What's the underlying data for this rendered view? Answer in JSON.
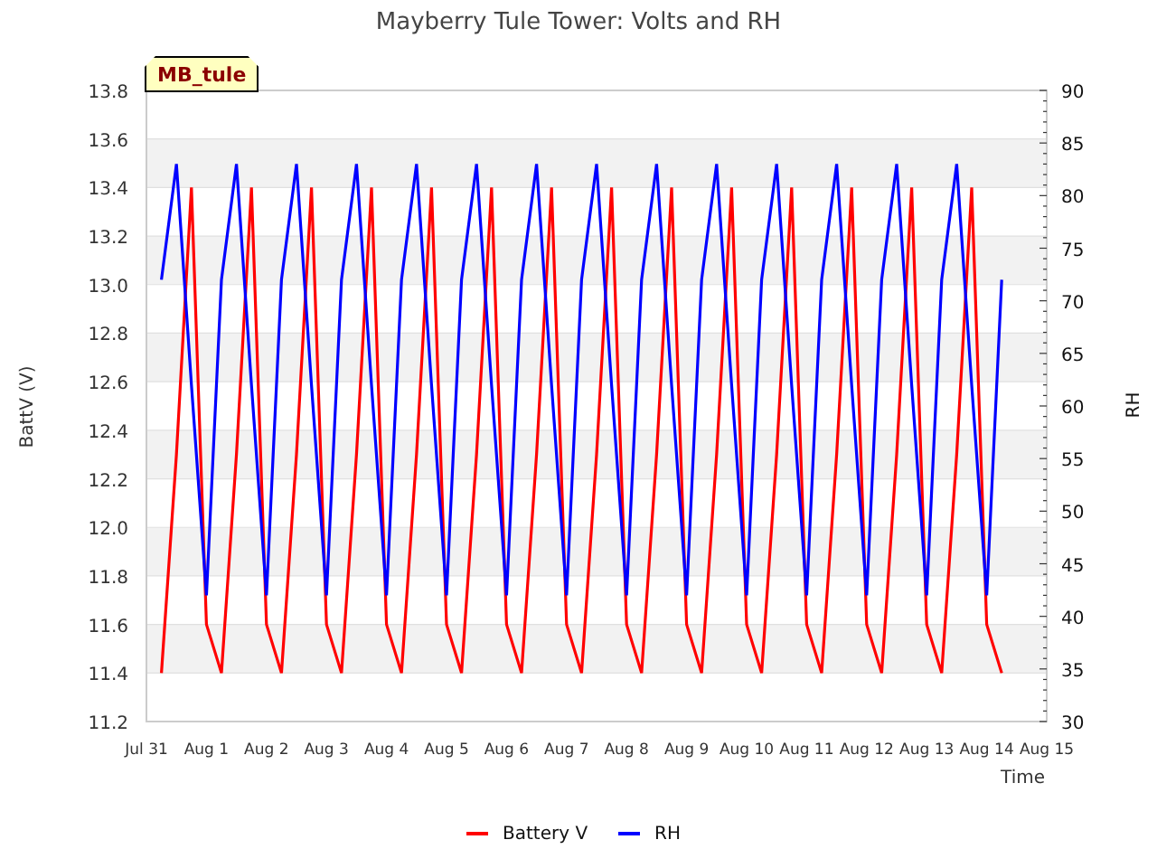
{
  "badge": "MB_tule",
  "chart_data": {
    "type": "line",
    "title": "Mayberry Tule Tower: Volts and RH",
    "xlabel": "Time",
    "ylabel": "BattV (V)",
    "y2label": "RH",
    "grid": true,
    "legend": "bottom",
    "ylim": [
      11.2,
      13.8
    ],
    "y2lim": [
      30,
      90
    ],
    "categories": [
      "Jul 31",
      null,
      null,
      null,
      "Aug 1",
      null,
      null,
      null,
      "Aug 2",
      null,
      null,
      null,
      "Aug 3",
      null,
      null,
      null,
      "Aug 4",
      null,
      null,
      null,
      "Aug 5",
      null,
      null,
      null,
      "Aug 6",
      null,
      null,
      null,
      "Aug 7",
      null,
      null,
      null,
      "Aug 8",
      null,
      null,
      null,
      "Aug 9",
      null,
      null,
      null,
      "Aug 10",
      null,
      null,
      null,
      "Aug 11",
      null,
      null,
      null,
      "Aug 12",
      null,
      null,
      null,
      "Aug 13",
      null,
      null,
      null,
      "Aug 14",
      null,
      null,
      null,
      "Aug 15"
    ],
    "yticks": [
      {
        "value": 11.2,
        "label": "11.2"
      },
      {
        "value": 11.4,
        "label": "11.4"
      },
      {
        "value": 11.6,
        "label": "11.6"
      },
      {
        "value": 11.8,
        "label": "11.8"
      },
      {
        "value": 12.0,
        "label": "12.0"
      },
      {
        "value": 12.2,
        "label": "12.2"
      },
      {
        "value": 12.4,
        "label": "12.4"
      },
      {
        "value": 12.6,
        "label": "12.6"
      },
      {
        "value": 12.8,
        "label": "12.8"
      },
      {
        "value": 13.0,
        "label": "13.0"
      },
      {
        "value": 13.2,
        "label": "13.2"
      },
      {
        "value": 13.4,
        "label": "13.4"
      },
      {
        "value": 13.6,
        "label": "13.6"
      },
      {
        "value": 13.8,
        "label": "13.8"
      }
    ],
    "y2ticks": [
      30,
      35,
      40,
      45,
      50,
      55,
      60,
      65,
      70,
      75,
      80,
      85,
      90
    ],
    "series": [
      {
        "name": "Battery V",
        "color": "#ff0000",
        "values": [
          null,
          11.4,
          12.3,
          13.4,
          11.6,
          11.4,
          12.3,
          13.4,
          11.6,
          11.4,
          12.3,
          13.4,
          11.6,
          11.4,
          12.3,
          13.4,
          11.6,
          11.4,
          12.3,
          13.4,
          11.6,
          11.4,
          12.3,
          13.4,
          11.6,
          11.4,
          12.3,
          13.4,
          11.6,
          11.4,
          12.3,
          13.4,
          11.6,
          11.4,
          12.3,
          13.4,
          11.6,
          11.4,
          12.3,
          13.4,
          11.6,
          11.4,
          12.3,
          13.4,
          11.6,
          11.4,
          12.3,
          13.4,
          11.6,
          11.4,
          12.3,
          13.4,
          11.6,
          11.4,
          12.3,
          13.4,
          11.6,
          11.4,
          null,
          null,
          null
        ]
      },
      {
        "name": "RH",
        "color": "#0000ff",
        "axis": "y2",
        "values": [
          null,
          72,
          83,
          62,
          42,
          72,
          83,
          62,
          42,
          72,
          83,
          62,
          42,
          72,
          83,
          62,
          42,
          72,
          83,
          62,
          42,
          72,
          83,
          62,
          42,
          72,
          83,
          62,
          42,
          72,
          83,
          62,
          42,
          72,
          83,
          62,
          42,
          72,
          83,
          62,
          42,
          72,
          83,
          62,
          42,
          72,
          83,
          62,
          42,
          72,
          83,
          62,
          42,
          72,
          83,
          62,
          42,
          72,
          null,
          null,
          null
        ]
      }
    ]
  }
}
